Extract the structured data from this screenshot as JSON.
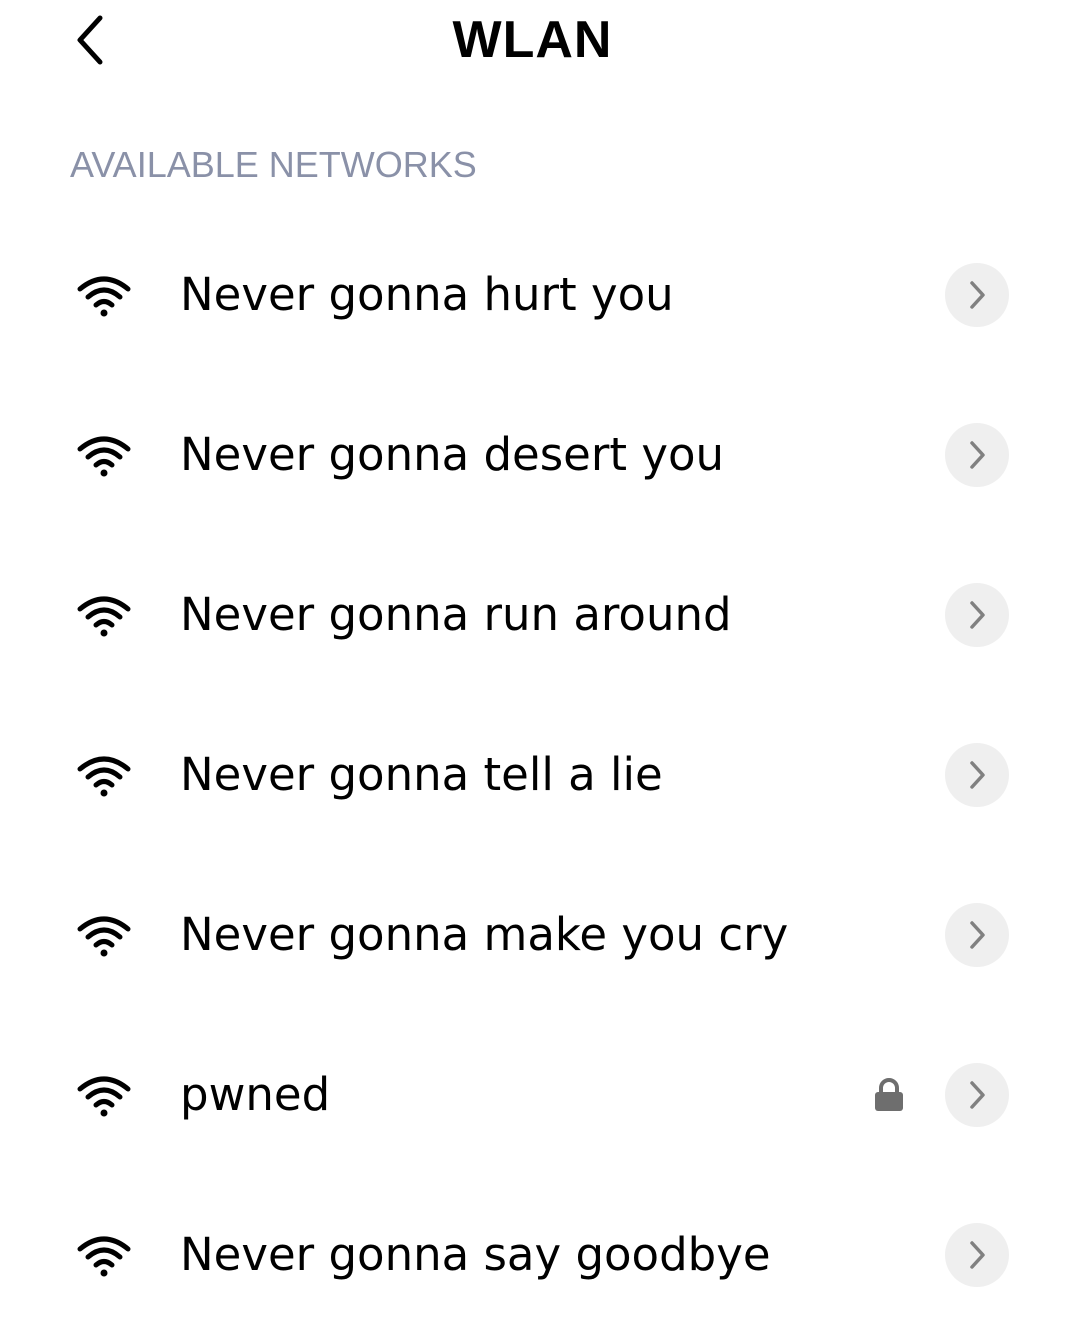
{
  "header": {
    "back_icon": "chevron-left-icon",
    "title": "WLAN"
  },
  "section": {
    "label": "AVAILABLE NETWORKS"
  },
  "networks": [
    {
      "name": "Never gonna hurt you",
      "secured": false,
      "signal": "full"
    },
    {
      "name": "Never gonna desert you",
      "secured": false,
      "signal": "full"
    },
    {
      "name": "Never gonna run around",
      "secured": false,
      "signal": "full"
    },
    {
      "name": "Never gonna tell a lie",
      "secured": false,
      "signal": "full"
    },
    {
      "name": "Never gonna make you cry",
      "secured": false,
      "signal": "full"
    },
    {
      "name": "pwned",
      "secured": true,
      "signal": "full"
    },
    {
      "name": "Never gonna say goodbye",
      "secured": false,
      "signal": "full"
    }
  ],
  "colors": {
    "section_label": "#8a91a8",
    "chevron_bg": "#efefef",
    "chevron_fg": "#808080",
    "lock": "#6e6e6e"
  }
}
